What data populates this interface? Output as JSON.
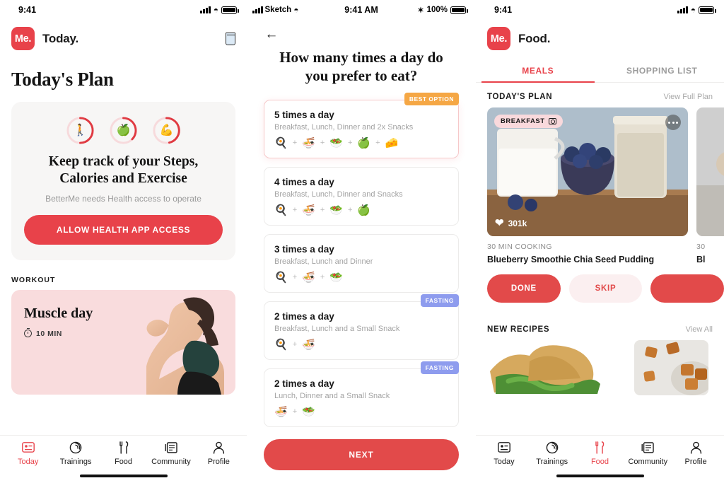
{
  "panel1": {
    "status": {
      "time": "9:41",
      "signal_icon": "cellular-bars-icon",
      "wifi_icon": "wifi-icon",
      "battery_icon": "battery-icon"
    },
    "header": {
      "logo_text": "Me.",
      "title": "Today.",
      "water_icon": "water-glass-icon"
    },
    "page_title": "Today's Plan",
    "health_card": {
      "rings": [
        {
          "icon": "🚶",
          "name": "steps-ring",
          "progress": 62
        },
        {
          "icon": "🍏",
          "name": "calories-ring",
          "progress": 55
        },
        {
          "icon": "💪",
          "name": "exercise-ring",
          "progress": 70
        }
      ],
      "heading": "Keep track of your Steps, Calories and Exercise",
      "subtext": "BetterMe needs Health access to operate",
      "button": "ALLOW HEALTH APP ACCESS"
    },
    "workout_label": "WORKOUT",
    "workout": {
      "title": "Muscle day",
      "duration": "10 MIN",
      "timer_icon": "stopwatch-icon"
    },
    "tabs": [
      {
        "label": "Today",
        "icon": "today-card-icon",
        "active": true
      },
      {
        "label": "Trainings",
        "icon": "trainings-spiral-icon",
        "active": false
      },
      {
        "label": "Food",
        "icon": "fork-knife-icon",
        "active": false
      },
      {
        "label": "Community",
        "icon": "community-list-icon",
        "active": false
      },
      {
        "label": "Profile",
        "icon": "person-icon",
        "active": false
      }
    ]
  },
  "panel2": {
    "status": {
      "carrier": "Sketch",
      "time": "9:41 AM",
      "bluetooth": "✶",
      "battery_pct": "100%"
    },
    "back_icon": "back-arrow-icon",
    "question": "How many times a day do you prefer to eat?",
    "options": [
      {
        "title": "5 times a day",
        "subtitle": "Breakfast, Lunch, Dinner and 2x Snacks",
        "emojis": [
          "🍳",
          "🍜",
          "🥗",
          "🍏",
          "🧀"
        ],
        "badge": "BEST OPTION",
        "badge_type": "best",
        "selected": true
      },
      {
        "title": "4 times a day",
        "subtitle": "Breakfast, Lunch, Dinner and Snacks",
        "emojis": [
          "🍳",
          "🍜",
          "🥗",
          "🍏"
        ],
        "badge": "",
        "badge_type": "",
        "selected": false
      },
      {
        "title": "3 times a day",
        "subtitle": "Breakfast, Lunch and Dinner",
        "emojis": [
          "🍳",
          "🍜",
          "🥗"
        ],
        "badge": "",
        "badge_type": "",
        "selected": false
      },
      {
        "title": "2 times a day",
        "subtitle": "Breakfast, Lunch and a Small Snack",
        "emojis": [
          "🍳",
          "🍜"
        ],
        "badge": "FASTING",
        "badge_type": "fast",
        "selected": false
      },
      {
        "title": "2 times a day",
        "subtitle": "Lunch, Dinner and a Small Snack",
        "emojis": [
          "🍜",
          "🥗"
        ],
        "badge": "FASTING",
        "badge_type": "fast",
        "selected": false
      }
    ],
    "next_button": "NEXT"
  },
  "panel3": {
    "status": {
      "time": "9:41"
    },
    "header": {
      "logo_text": "Me.",
      "title": "Food."
    },
    "tabs": [
      {
        "label": "MEALS",
        "active": true
      },
      {
        "label": "SHOPPING LIST",
        "active": false
      }
    ],
    "plan_section": {
      "title": "TODAY'S PLAN",
      "action": "View Full Plan"
    },
    "meal": {
      "chip": "BREAKFAST",
      "chip_icon": "camera-icon",
      "more_icon": "more-dots-icon",
      "likes": "301k",
      "heart_icon": "heart-icon",
      "cooking_time": "30 MIN COOKING",
      "name": "Blueberry Smoothie Chia Seed Pudding"
    },
    "meal_peek": {
      "cooking_time": "30",
      "name": "Bl"
    },
    "actions": {
      "done": "DONE",
      "skip": "SKIP",
      "more": ""
    },
    "recipes_section": {
      "title": "NEW RECIPES",
      "action": "View All"
    },
    "tabs_bottom": [
      {
        "label": "Today",
        "icon": "today-card-icon",
        "active": false
      },
      {
        "label": "Trainings",
        "icon": "trainings-spiral-icon",
        "active": false
      },
      {
        "label": "Food",
        "icon": "fork-knife-icon",
        "active": true
      },
      {
        "label": "Community",
        "icon": "community-list-icon",
        "active": false
      },
      {
        "label": "Profile",
        "icon": "person-icon",
        "active": false
      }
    ]
  },
  "colors": {
    "brand": "#E8424A",
    "accent_orange": "#F5A745",
    "accent_blue": "#8E9CEE",
    "pink_bg": "#F9DCDD"
  }
}
